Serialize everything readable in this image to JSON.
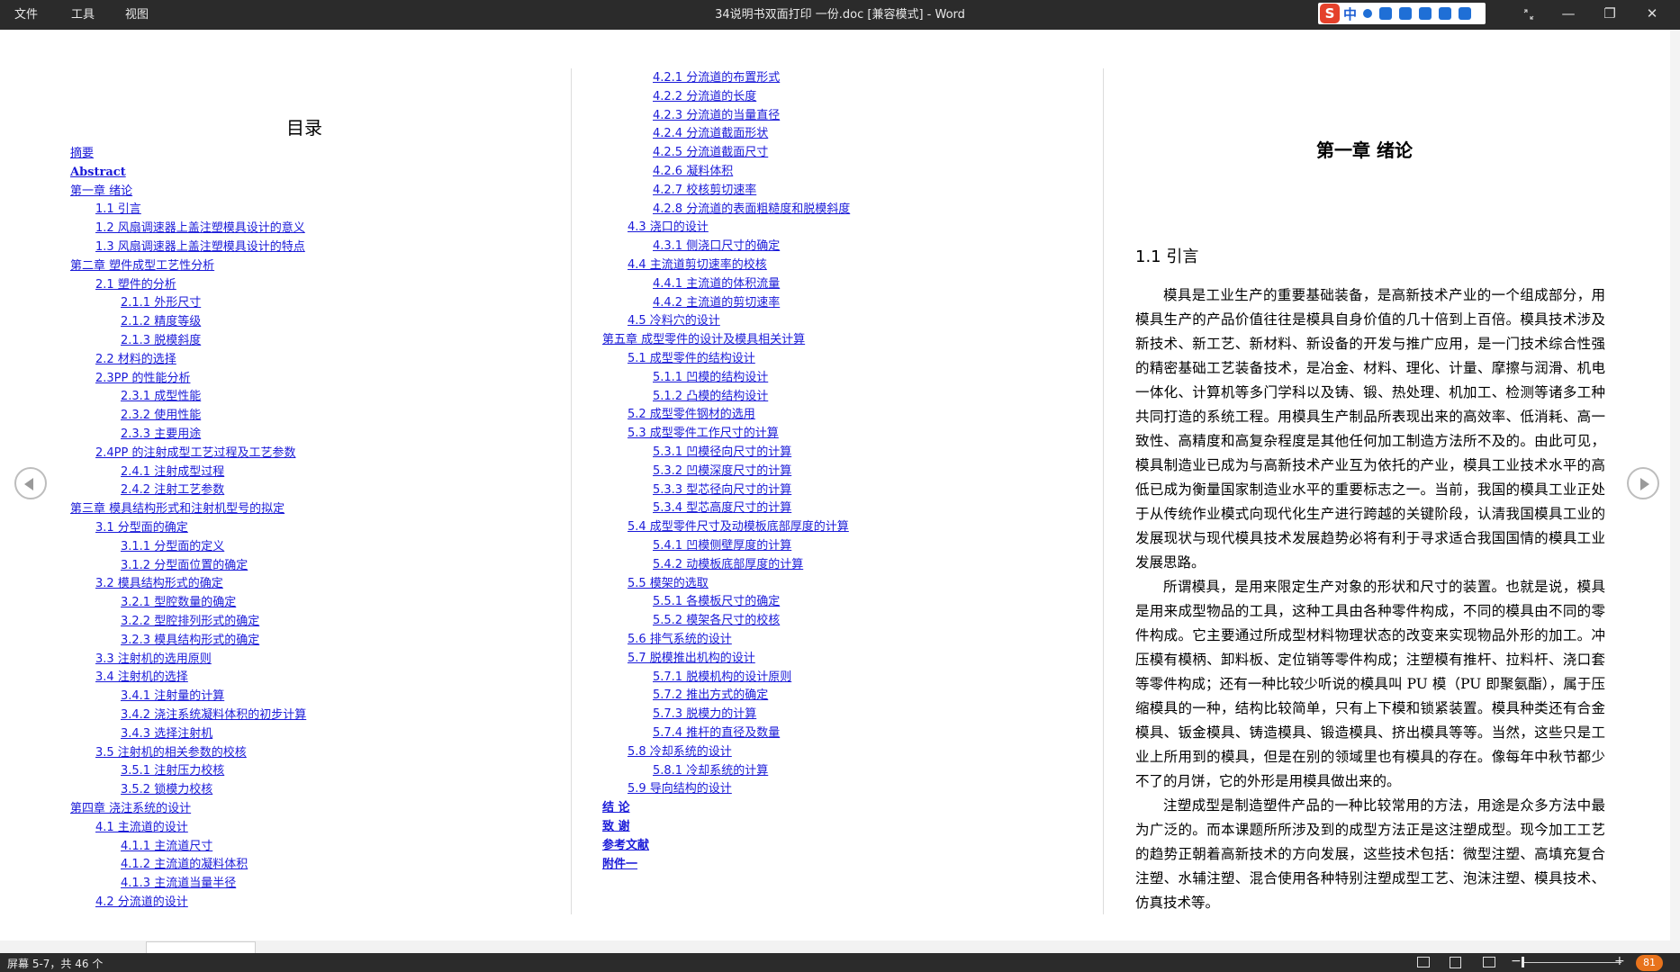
{
  "titlebar": {
    "menus": [
      "文件",
      "工具",
      "视图"
    ],
    "title": "34说明书双面打印 一份.doc [兼容模式] - Word",
    "ime_logo": "S",
    "ime_lang": "中",
    "restore_icon": "restore-icon",
    "minimize_glyph": "—",
    "maximize_glyph": "❐",
    "close_glyph": "✕"
  },
  "toc": {
    "title": "目录",
    "col1": [
      {
        "text": "摘要",
        "level": 0,
        "bold": false
      },
      {
        "text": "Abstract",
        "level": 0,
        "bold": true
      },
      {
        "text": "第一章  绪论",
        "level": 0,
        "bold": false
      },
      {
        "text": "1.1 引言",
        "level": 1,
        "bold": false
      },
      {
        "text": "1.2 风扇调速器上盖注塑模具设计的意义",
        "level": 1,
        "bold": false
      },
      {
        "text": "1.3 风扇调速器上盖注塑模具设计的特点",
        "level": 1,
        "bold": false
      },
      {
        "text": "第二章  塑件成型工艺性分析",
        "level": 0,
        "bold": false
      },
      {
        "text": "2.1 塑件的分析",
        "level": 1,
        "bold": false
      },
      {
        "text": "2.1.1 外形尺寸",
        "level": 2,
        "bold": false
      },
      {
        "text": "2.1.2 精度等级",
        "level": 2,
        "bold": false
      },
      {
        "text": "2.1.3 脱模斜度",
        "level": 2,
        "bold": false
      },
      {
        "text": "2.2 材料的选择",
        "level": 1,
        "bold": false
      },
      {
        "text": "2.3PP 的性能分析",
        "level": 1,
        "bold": false
      },
      {
        "text": "2.3.1 成型性能",
        "level": 2,
        "bold": false
      },
      {
        "text": "2.3.2 使用性能",
        "level": 2,
        "bold": false
      },
      {
        "text": "2.3.3 主要用途",
        "level": 2,
        "bold": false
      },
      {
        "text": "2.4PP 的注射成型工艺过程及工艺参数",
        "level": 1,
        "bold": false
      },
      {
        "text": "2.4.1 注射成型过程",
        "level": 2,
        "bold": false
      },
      {
        "text": "2.4.2 注射工艺参数",
        "level": 2,
        "bold": false
      },
      {
        "text": "第三章  模具结构形式和注射机型号的拟定",
        "level": 0,
        "bold": false
      },
      {
        "text": "3.1 分型面的确定",
        "level": 1,
        "bold": false
      },
      {
        "text": "3.1.1 分型面的定义",
        "level": 2,
        "bold": false
      },
      {
        "text": "3.1.2 分型面位置的确定",
        "level": 2,
        "bold": false
      },
      {
        "text": "3.2 模具结构形式的确定",
        "level": 1,
        "bold": false
      },
      {
        "text": "3.2.1 型腔数量的确定",
        "level": 2,
        "bold": false
      },
      {
        "text": "3.2.2 型腔排列形式的确定",
        "level": 2,
        "bold": false
      },
      {
        "text": "3.2.3 模具结构形式的确定",
        "level": 2,
        "bold": false
      },
      {
        "text": "3.3 注射机的选用原则",
        "level": 1,
        "bold": false
      },
      {
        "text": "3.4 注射机的选择",
        "level": 1,
        "bold": false
      },
      {
        "text": "3.4.1 注射量的计算",
        "level": 2,
        "bold": false
      },
      {
        "text": "3.4.2 浇注系统凝料体积的初步计算",
        "level": 2,
        "bold": false
      },
      {
        "text": "3.4.3 选择注射机",
        "level": 2,
        "bold": false
      },
      {
        "text": "3.5 注射机的相关参数的校核",
        "level": 1,
        "bold": false
      },
      {
        "text": "3.5.1 注射压力校核",
        "level": 2,
        "bold": false
      },
      {
        "text": "3.5.2 锁模力校核",
        "level": 2,
        "bold": false
      },
      {
        "text": "第四章  浇注系统的设计",
        "level": 0,
        "bold": false
      },
      {
        "text": "4.1 主流道的设计",
        "level": 1,
        "bold": false
      },
      {
        "text": "4.1.1 主流道尺寸",
        "level": 2,
        "bold": false
      },
      {
        "text": "4.1.2 主流道的凝料体积",
        "level": 2,
        "bold": false
      },
      {
        "text": "4.1.3 主流道当量半径",
        "level": 2,
        "bold": false
      },
      {
        "text": "4.2 分流道的设计",
        "level": 1,
        "bold": false
      }
    ],
    "col2": [
      {
        "text": "4.2.1 分流道的布置形式",
        "level": 2,
        "bold": false
      },
      {
        "text": "4.2.2 分流道的长度",
        "level": 2,
        "bold": false
      },
      {
        "text": "4.2.3 分流道的当量直径",
        "level": 2,
        "bold": false
      },
      {
        "text": "4.2.4 分流道截面形状",
        "level": 2,
        "bold": false
      },
      {
        "text": "4.2.5 分流道截面尺寸",
        "level": 2,
        "bold": false
      },
      {
        "text": "4.2.6 凝料体积",
        "level": 2,
        "bold": false
      },
      {
        "text": "4.2.7 校核剪切速率",
        "level": 2,
        "bold": false
      },
      {
        "text": "4.2.8 分流道的表面粗糙度和脱模斜度",
        "level": 2,
        "bold": false
      },
      {
        "text": "4.3 浇口的设计",
        "level": 1,
        "bold": false
      },
      {
        "text": "4.3.1 侧浇口尺寸的确定",
        "level": 2,
        "bold": false
      },
      {
        "text": "4.4 主流道剪切速率的校核",
        "level": 1,
        "bold": false
      },
      {
        "text": "4.4.1 主流道的体积流量",
        "level": 2,
        "bold": false
      },
      {
        "text": "4.4.2 主流道的剪切速率",
        "level": 2,
        "bold": false
      },
      {
        "text": "4.5 冷料穴的设计",
        "level": 1,
        "bold": false
      },
      {
        "text": "第五章  成型零件的设计及模具相关计算",
        "level": 0,
        "bold": false
      },
      {
        "text": "5.1 成型零件的结构设计",
        "level": 1,
        "bold": false
      },
      {
        "text": "5.1.1 凹模的结构设计",
        "level": 2,
        "bold": false
      },
      {
        "text": "5.1.2 凸模的结构设计",
        "level": 2,
        "bold": false
      },
      {
        "text": "5.2 成型零件钢材的选用",
        "level": 1,
        "bold": false
      },
      {
        "text": "5.3 成型零件工作尺寸的计算",
        "level": 1,
        "bold": false
      },
      {
        "text": "5.3.1 凹模径向尺寸的计算",
        "level": 2,
        "bold": false
      },
      {
        "text": "5.3.2 凹模深度尺寸的计算",
        "level": 2,
        "bold": false
      },
      {
        "text": "5.3.3 型芯径向尺寸的计算",
        "level": 2,
        "bold": false
      },
      {
        "text": "5.3.4 型芯高度尺寸的计算",
        "level": 2,
        "bold": false
      },
      {
        "text": "5.4 成型零件尺寸及动模板底部厚度的计算",
        "level": 1,
        "bold": false
      },
      {
        "text": "5.4.1 凹模侧壁厚度的计算",
        "level": 2,
        "bold": false
      },
      {
        "text": "5.4.2 动模板底部厚度的计算",
        "level": 2,
        "bold": false
      },
      {
        "text": "5.5 模架的选取",
        "level": 1,
        "bold": false
      },
      {
        "text": "5.5.1 各模板尺寸的确定",
        "level": 2,
        "bold": false
      },
      {
        "text": "5.5.2 模架各尺寸的校核",
        "level": 2,
        "bold": false
      },
      {
        "text": "5.6 排气系统的设计",
        "level": 1,
        "bold": false
      },
      {
        "text": "5.7 脱模推出机构的设计",
        "level": 1,
        "bold": false
      },
      {
        "text": "5.7.1 脱模机构的设计原则",
        "level": 2,
        "bold": false
      },
      {
        "text": "5.7.2 推出方式的确定",
        "level": 2,
        "bold": false
      },
      {
        "text": "5.7.3 脱模力的计算",
        "level": 2,
        "bold": false
      },
      {
        "text": "5.7.4 推杆的直径及数量",
        "level": 2,
        "bold": false
      },
      {
        "text": "5.8 冷却系统的设计",
        "level": 1,
        "bold": false
      },
      {
        "text": "5.8.1 冷却系统的计算",
        "level": 2,
        "bold": false
      },
      {
        "text": "5.9 导向结构的设计",
        "level": 1,
        "bold": false
      },
      {
        "text": "结    论",
        "level": 0,
        "bold": true
      },
      {
        "text": "致    谢",
        "level": 0,
        "bold": true
      },
      {
        "text": "参考文献",
        "level": 0,
        "bold": true
      },
      {
        "text": "附件一",
        "level": 0,
        "bold": true
      }
    ]
  },
  "chapter": {
    "title": "第一章  绪论",
    "section": "1.1 引言",
    "paragraphs": [
      "模具是工业生产的重要基础装备，是高新技术产业的一个组成部分，用模具生产的产品价值往往是模具自身价值的几十倍到上百倍。模具技术涉及新技术、新工艺、新材料、新设备的开发与推广应用，是一门技术综合性强的精密基础工艺装备技术，是冶金、材料、理化、计量、摩擦与润滑、机电一体化、计算机等多门学科以及铸、锻、热处理、机加工、检测等诸多工种共同打造的系统工程。用模具生产制品所表现出来的高效率、低消耗、高一致性、高精度和高复杂程度是其他任何加工制造方法所不及的。由此可见，模具制造业已成为与高新技术产业互为依托的产业，模具工业技术水平的高低已成为衡量国家制造业水平的重要标志之一。当前，我国的模具工业正处于从传统作业模式向现代化生产进行跨越的关键阶段，认清我国模具工业的发展现状与现代模具技术发展趋势必将有利于寻求适合我国国情的模具工业发展思路。",
      "所谓模具，是用来限定生产对象的形状和尺寸的装置。也就是说，模具是用来成型物品的工具，这种工具由各种零件构成，不同的模具由不同的零件构成。它主要通过所成型材料物理状态的改变来实现物品外形的加工。冲压模有模柄、卸料板、定位销等零件构成；注塑模有推杆、拉料杆、浇口套等零件构成；还有一种比较少听说的模具叫 PU 模（PU 即聚氨酯），属于压缩模具的一种，结构比较简单，只有上下模和锁紧装置。模具种类还有合金模具、钣金模具、铸造模具、锻造模具、挤出模具等等。当然，这些只是工业上所用到的模具，但是在别的领域里也有模具的存在。像每年中秋节都少不了的月饼，它的外形是用模具做出来的。",
      "注塑成型是制造塑件产品的一种比较常用的方法，用途是众多方法中最为广泛的。而本课题所所涉及到的成型方法正是这注塑成型。现今加工工艺的趋势正朝着高新技术的方向发展，这些技术包括：微型注塑、高填充复合注塑、水辅注塑、混合使用各种特别注塑成型工艺、泡沫注塑、模具技术、仿真技术等。"
    ]
  },
  "nav": {
    "prev_icon": "prev-page-icon",
    "next_icon": "next-page-icon"
  },
  "status": {
    "page_info": "屏幕 5-7，共 46 个",
    "zoom_minus": "−",
    "zoom_plus": "+",
    "zoom_value": "81"
  },
  "colors": {
    "link": "#1a1ad8",
    "chrome": "#2b2b2b",
    "zoom_badge": "#e8731c"
  }
}
